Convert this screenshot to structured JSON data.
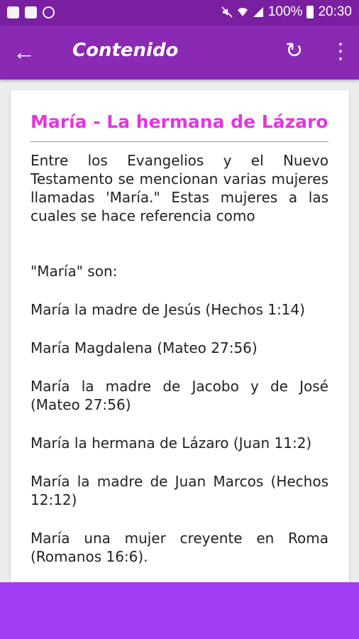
{
  "status_bar": {
    "icons_left": [
      "facebook-icon",
      "gallery-icon",
      "whatsapp-icon"
    ],
    "mute_icon": "mute-icon",
    "wifi_icon": "wifi-icon",
    "signal_icon": "signal-icon",
    "battery": "100%",
    "time": "20:30"
  },
  "app_bar": {
    "title": "Contenido",
    "back_icon": "←",
    "refresh_icon": "↻",
    "more_icon": "⋮"
  },
  "article": {
    "title": "María - La hermana de Lázaro",
    "intro": "Entre los Evangelios y el Nuevo Testamento se mencionan varias mujeres llamadas 'María.\" Estas mujeres a las cuales se hace referencia como",
    "lead": "\"María\" son:",
    "items": [
      "María la madre de Jesús (Hechos 1:14)",
      "María Magdalena (Mateo 27:56)",
      "María la madre de Jacobo y de José (Mateo 27:56)",
      "María la hermana de Lázaro (Juan 11:2)",
      "María la madre de Juan Marcos (Hechos 12:12)",
      "María una mujer creyente en Roma (Romanos 16:6)."
    ]
  },
  "colors": {
    "status_bar": "#7a1fa2",
    "app_bar": "#8a29b3",
    "title": "#e535e0",
    "bottom_bar": "#a43ef2"
  }
}
